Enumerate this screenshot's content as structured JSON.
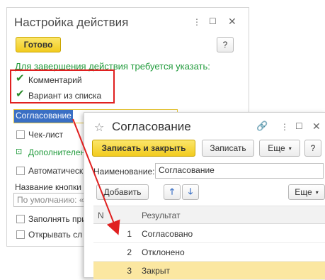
{
  "back_window": {
    "title": "Настройка действия",
    "ready_button": "Готово",
    "help_button": "?",
    "prompt": "Для завершения действия требуется указать:",
    "options": [
      {
        "label": "Комментарий",
        "checked": true
      },
      {
        "label": "Вариант из списка",
        "checked": true
      }
    ],
    "selected_value": "Согласование",
    "checklist_label": "Чек-лист",
    "additional_label": "Дополнителен",
    "automatic_label": "Автоматическ",
    "button_name_label": "Название кнопки",
    "default_placeholder": "По умолчанию: «",
    "fill_label": "Заполнять при",
    "open_label": "Открывать сл"
  },
  "front_window": {
    "title": "Согласование",
    "save_close_button": "Записать и закрыть",
    "save_button": "Записать",
    "more_button": "Еще",
    "help_button": "?",
    "name_label": "Наименование:",
    "name_value": "Согласование",
    "add_button": "Добавить",
    "table_more_button": "Еще",
    "columns": [
      "N",
      "Результат"
    ],
    "rows": [
      {
        "n": "1",
        "result": "Согласовано"
      },
      {
        "n": "2",
        "result": "Отклонено"
      },
      {
        "n": "3",
        "result": "Закрыт"
      }
    ]
  },
  "colors": {
    "accent_yellow": "#f4d23c",
    "highlight_red": "#e02020",
    "check_green": "#2a8a2a",
    "selection_blue": "#3a6fc4",
    "prompt_green": "#1f9a3a"
  }
}
